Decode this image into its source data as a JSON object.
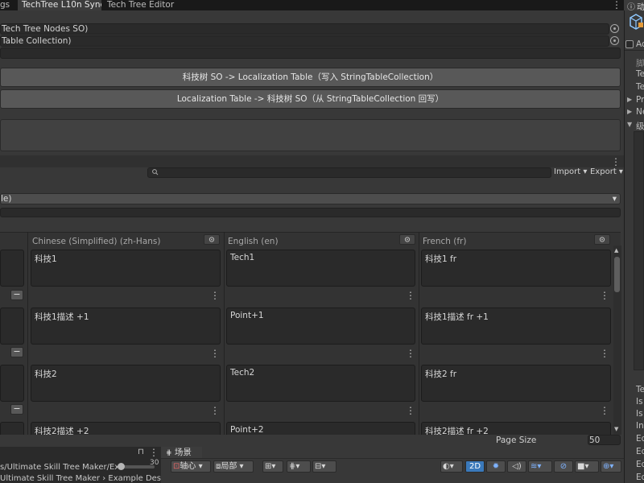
{
  "tabs": [
    "gs",
    "TechTree L10n Sync",
    "Tech Tree Editor"
  ],
  "fields": {
    "nodes": "Tech Tree Nodes SO)",
    "table": "Table Collection)"
  },
  "buttons": {
    "to_localization": "科技树 SO -> Localization Table（写入 StringTableCollection）",
    "to_so": "Localization Table -> 科技树 SO（从 StringTableCollection 回写）"
  },
  "toolbar": {
    "import_label": "Import",
    "export_label": "Export",
    "search_placeholder": "",
    "table_dropdown": "le)"
  },
  "table": {
    "columns": [
      {
        "label": "Chinese (Simplified) (zh-Hans)"
      },
      {
        "label": "English (en)"
      },
      {
        "label": "French (fr)"
      }
    ],
    "rows": [
      {
        "cells": [
          "科技1",
          "Tech1",
          "科技1 fr"
        ]
      },
      {
        "cells": [
          "科技1描述 +1",
          "Point+1",
          "科技1描述 fr +1"
        ]
      },
      {
        "cells": [
          "科技2",
          "Tech2",
          "科技2 fr"
        ]
      },
      {
        "cells": [
          "科技2描述 +2",
          "Point+2",
          "科技2描述 fr +2"
        ]
      }
    ]
  },
  "footer": {
    "page_size_label": "Page Size",
    "page_size_value": "50"
  },
  "bottom_left": {
    "path1": "s/Ultimate Skill Tree Maker/Exa",
    "path2": "Ultimate Skill Tree Maker › Example Des",
    "slider_value": "30"
  },
  "scene": {
    "tab_label": "场景",
    "pivot_label": "轴心",
    "local_label": "局部",
    "mode_2d": "2D"
  },
  "right_panel": {
    "header": "动",
    "checkbox_label": "Ac",
    "labels_top": [
      "脚",
      "Te",
      "Te",
      "Pre",
      "Ne",
      "级"
    ],
    "labels_bottom": [
      "Te",
      "Is",
      "Is",
      "Ini",
      "Ed",
      "Ed",
      "Ed",
      "Ed",
      "Un"
    ]
  },
  "colors": {
    "accent": "#3a79bb",
    "button": "#585858",
    "field": "#2a2a2a",
    "panel": "#383838"
  }
}
